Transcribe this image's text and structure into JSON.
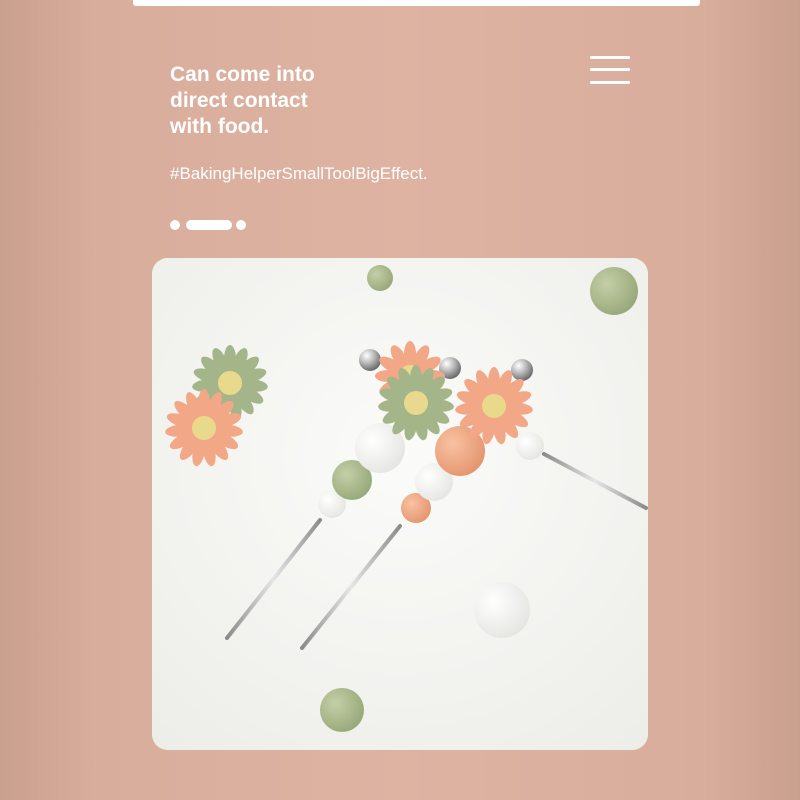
{
  "hero": {
    "headline": "Can come into\ndirect contact\nwith food.",
    "hashtag": "#BakingHelperSmallToolBigEffect."
  },
  "menu": {
    "icon": "hamburger-menu-icon"
  },
  "carousel": {
    "slide_count": 3,
    "active_index": 1
  },
  "colors": {
    "background": "#dfb3a2",
    "text": "#ffffff",
    "sage": "#a9b98c",
    "peach": "#eea682",
    "card": "#f2f2ef"
  }
}
